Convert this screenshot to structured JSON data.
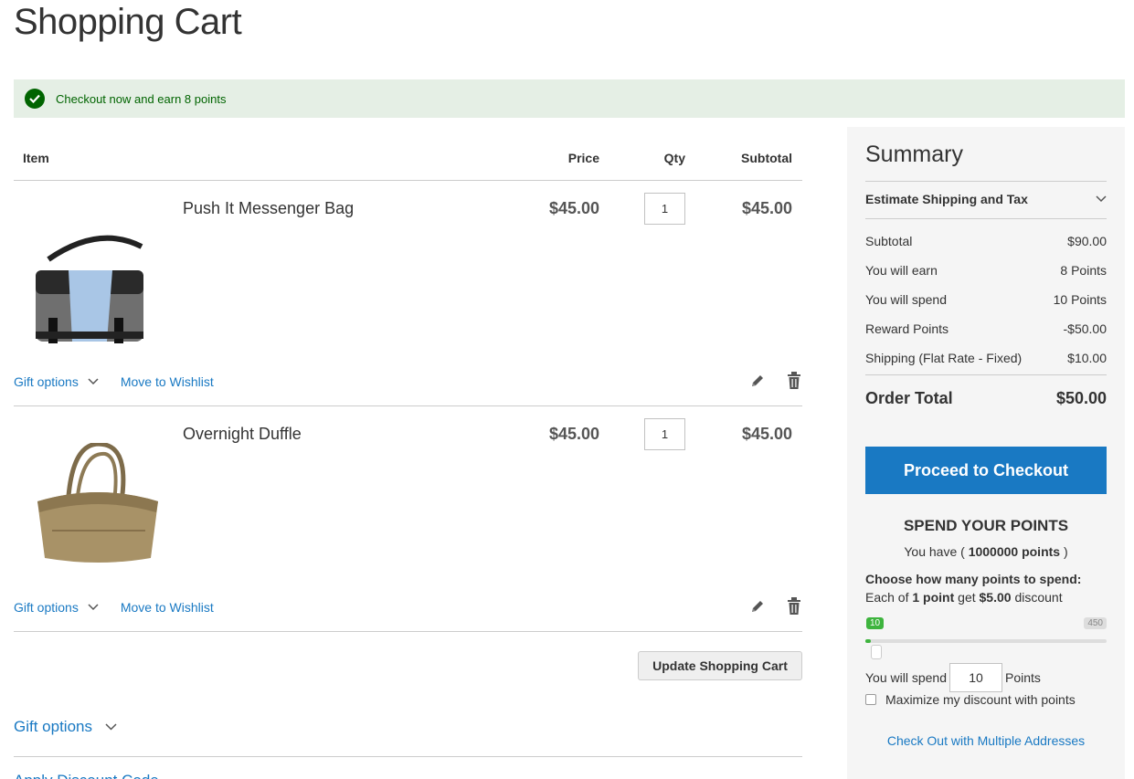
{
  "page": {
    "title": "Shopping Cart"
  },
  "message": {
    "text": "Checkout now and earn 8 points"
  },
  "cart": {
    "headers": {
      "item": "Item",
      "price": "Price",
      "qty": "Qty",
      "subtotal": "Subtotal"
    },
    "items": [
      {
        "name": "Push It Messenger Bag",
        "price": "$45.00",
        "qty": "1",
        "subtotal": "$45.00",
        "gift_label": "Gift options",
        "wishlist_label": "Move to Wishlist"
      },
      {
        "name": "Overnight Duffle",
        "price": "$45.00",
        "qty": "1",
        "subtotal": "$45.00",
        "gift_label": "Gift options",
        "wishlist_label": "Move to Wishlist"
      }
    ],
    "update_label": "Update Shopping Cart",
    "gift_options_label": "Gift options",
    "discount_label": "Apply Discount Code"
  },
  "summary": {
    "title": "Summary",
    "estimate_label": "Estimate Shipping and Tax",
    "totals": [
      {
        "label": "Subtotal",
        "value": "$90.00"
      },
      {
        "label": "You will earn",
        "value": "8 Points"
      },
      {
        "label": "You will spend",
        "value": "10 Points"
      },
      {
        "label": "Reward Points",
        "value": "-$50.00"
      },
      {
        "label": "Shipping (Flat Rate - Fixed)",
        "value": "$10.00"
      }
    ],
    "order_total_label": "Order Total",
    "order_total_value": "$50.00",
    "checkout_label": "Proceed to Checkout",
    "multi_address_label": "Check Out with Multiple Addresses"
  },
  "points": {
    "title": "SPEND YOUR POINTS",
    "you_have_prefix": "You have ( ",
    "balance": "1000000 points",
    "you_have_suffix": " )",
    "choose_label": "Choose how many points to spend:",
    "each_prefix": "Each of ",
    "each_point": "1 point",
    "each_mid": " get ",
    "each_amount": "$5.00",
    "each_suffix": " discount",
    "slider_min_label": "10",
    "slider_max_label": "450",
    "slider_value": 10,
    "slider_min": 0,
    "slider_max": 450,
    "spend_prefix": "You will spend",
    "spend_value": "10",
    "spend_suffix": "Points",
    "maximize_label": "Maximize my discount with points"
  },
  "colors": {
    "link": "#1979c3",
    "success": "#006400",
    "slider": "#3eb43e"
  }
}
